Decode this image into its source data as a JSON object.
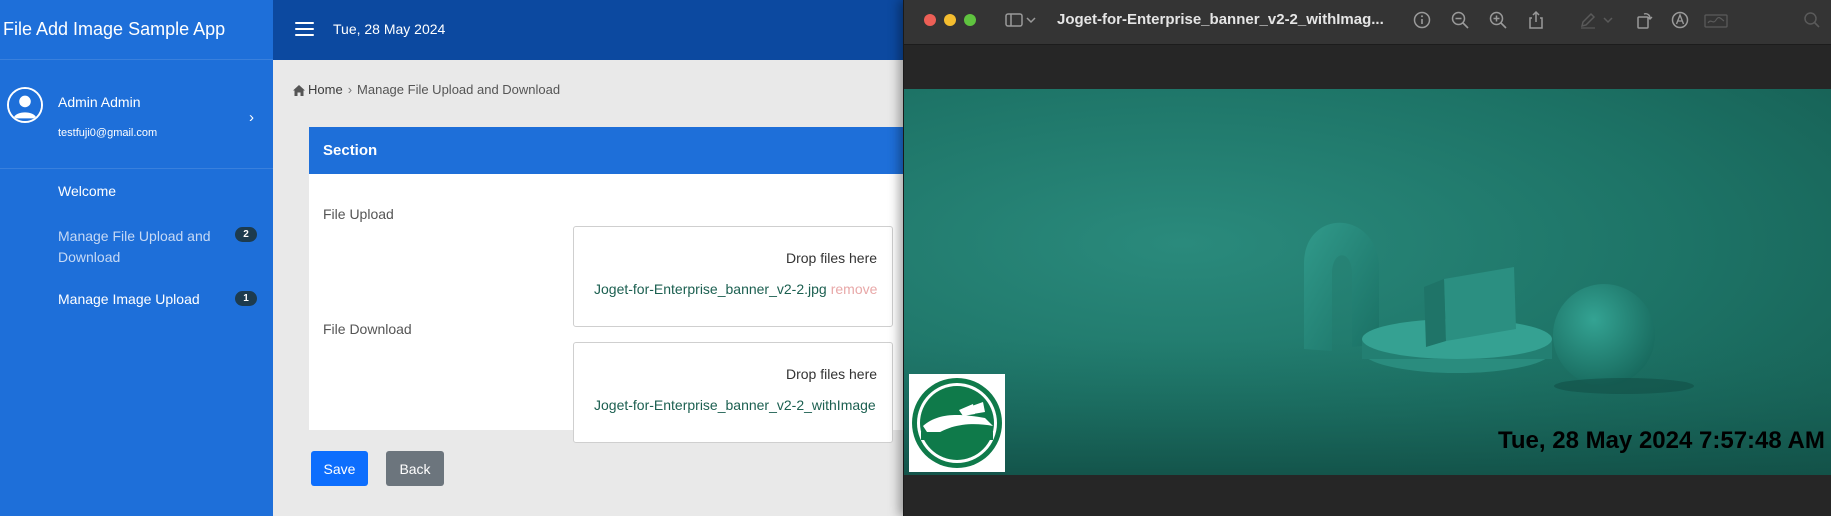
{
  "app": {
    "title": "File Add Image Sample App"
  },
  "user": {
    "name": "Admin Admin",
    "email": "testfuji0@gmail.com"
  },
  "sidebar": {
    "items": [
      {
        "label": "Welcome",
        "badge": ""
      },
      {
        "label": "Manage File Upload and Download",
        "badge": "2"
      },
      {
        "label": "Manage Image Upload",
        "badge": "1"
      }
    ]
  },
  "topbar": {
    "date": "Tue, 28 May 2024"
  },
  "breadcrumb": {
    "home": "Home",
    "current": "Manage File Upload and Download"
  },
  "form": {
    "section_title": "Section",
    "fields": [
      {
        "label": "File Upload",
        "drop_text": "Drop files here",
        "file_name": "Joget-for-Enterprise_banner_v2-2.jpg",
        "remove_label": "remove"
      },
      {
        "label": "File Download",
        "drop_text": "Drop files here",
        "file_name": "Joget-for-Enterprise_banner_v2-2_withImage"
      }
    ],
    "buttons": {
      "save": "Save",
      "back": "Back"
    }
  },
  "preview": {
    "window_title": "Joget-for-Enterprise_banner_v2-2_withImag...",
    "stamp_text": "Tue, 28 May 2024 7:57:48 AM",
    "toolbar_icons": [
      "sidebar-toggle-icon",
      "chevron-down-icon",
      "info-icon",
      "zoom-out-icon",
      "zoom-in-icon",
      "share-icon",
      "markup-pen-icon",
      "rotate-icon",
      "annotate-icon",
      "signature-icon",
      "search-icon"
    ]
  },
  "colors": {
    "sidebar": "#1e6fd9",
    "topbar": "#0c49a0",
    "badge": "#1d3b4e",
    "save": "#0d6efd",
    "back": "#6c757d",
    "file_link": "#1b5f50",
    "image_teal": "#1d7366"
  }
}
